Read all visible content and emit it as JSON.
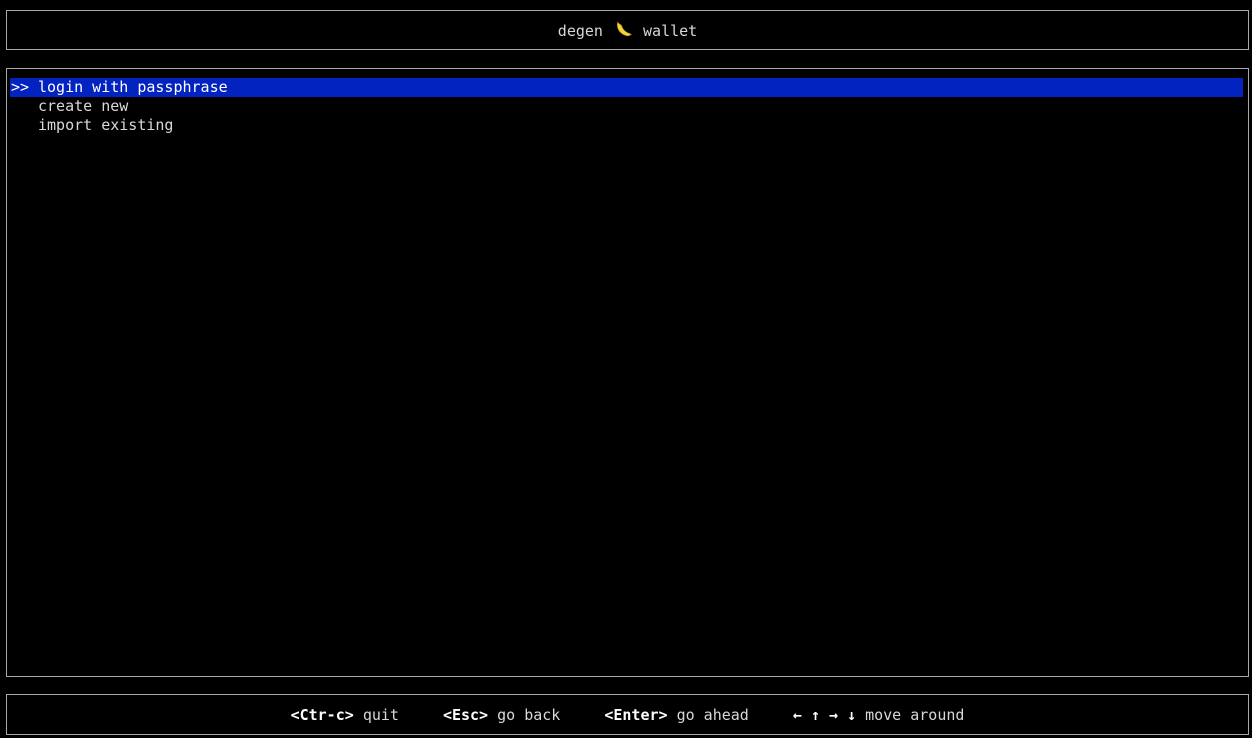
{
  "header": {
    "title_left": "degen",
    "title_icon": "banana-icon",
    "title_right": "wallet"
  },
  "menu": {
    "pointer": ">>",
    "items": [
      {
        "label": "login with passphrase",
        "selected": true
      },
      {
        "label": "create new",
        "selected": false
      },
      {
        "label": "import existing",
        "selected": false
      }
    ],
    "highlight_color": "#0323c0"
  },
  "footer": {
    "hints": [
      {
        "key": "<Ctr-c>",
        "action": "quit"
      },
      {
        "key": "<Esc>",
        "action": "go back"
      },
      {
        "key": "<Enter>",
        "action": "go ahead"
      },
      {
        "key": "← ↑ → ↓",
        "action": "move around"
      }
    ]
  }
}
